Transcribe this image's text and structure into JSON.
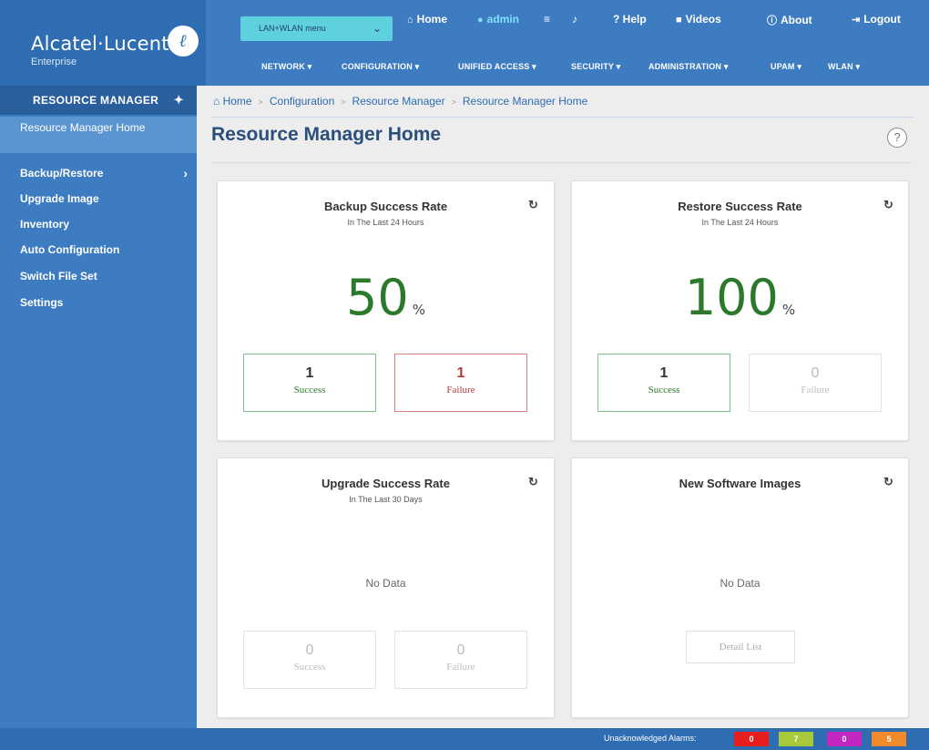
{
  "brand": {
    "name": "Alcatel·Lucent",
    "sub": "Enterprise",
    "logo_glyph": "ℓ"
  },
  "topbar": {
    "lan_select": "LAN+WLAN menu",
    "home": "Home",
    "admin": "admin",
    "help": "? Help",
    "videos": "Videos",
    "about": "About",
    "logout": "Logout"
  },
  "menu": [
    "NETWORK ▾",
    "CONFIGURATION ▾",
    "UNIFIED ACCESS ▾",
    "SECURITY ▾",
    "ADMINISTRATION ▾",
    "UPAM ▾",
    "WLAN ▾"
  ],
  "sidebar": {
    "header": "RESOURCE MANAGER",
    "active": "Resource Manager Home",
    "items": [
      "Backup/Restore",
      "Upgrade Image",
      "Inventory",
      "Auto Configuration",
      "Switch File Set",
      "Settings"
    ]
  },
  "breadcrumb": [
    "Home",
    "Configuration",
    "Resource Manager",
    "Resource Manager Home"
  ],
  "page_title": "Resource Manager Home",
  "cards": {
    "backup": {
      "title": "Backup Success Rate",
      "sub": "In The Last 24 Hours",
      "rate": "50",
      "unit": "%",
      "success_count": "1",
      "success_label": "Success",
      "failure_count": "1",
      "failure_label": "Failure"
    },
    "restore": {
      "title": "Restore Success Rate",
      "sub": "In The Last 24 Hours",
      "rate": "100",
      "unit": "%",
      "success_count": "1",
      "success_label": "Success",
      "failure_count": "0",
      "failure_label": "Failure"
    },
    "upgrade": {
      "title": "Upgrade Success Rate",
      "sub": "In The Last 30 Days",
      "nodata": "No Data",
      "success_count": "0",
      "success_label": "Success",
      "failure_count": "0",
      "failure_label": "Failure"
    },
    "images": {
      "title": "New Software Images",
      "nodata": "No Data",
      "detail_button": "Detail List"
    }
  },
  "footer": {
    "alarm_label": "Unacknowledged Alarms:",
    "alarms": [
      {
        "value": "0",
        "color": "#e81d1d"
      },
      {
        "value": "7",
        "color": "#a9c83a"
      },
      {
        "value": "0",
        "color": "#c227c2"
      },
      {
        "value": "5",
        "color": "#f08a2a"
      }
    ]
  },
  "colors": {
    "header": "#3d7cc0",
    "sidebar": "#3d7cc0",
    "accent_green": "#2b7a2b",
    "failure_red": "#b03a3a"
  }
}
